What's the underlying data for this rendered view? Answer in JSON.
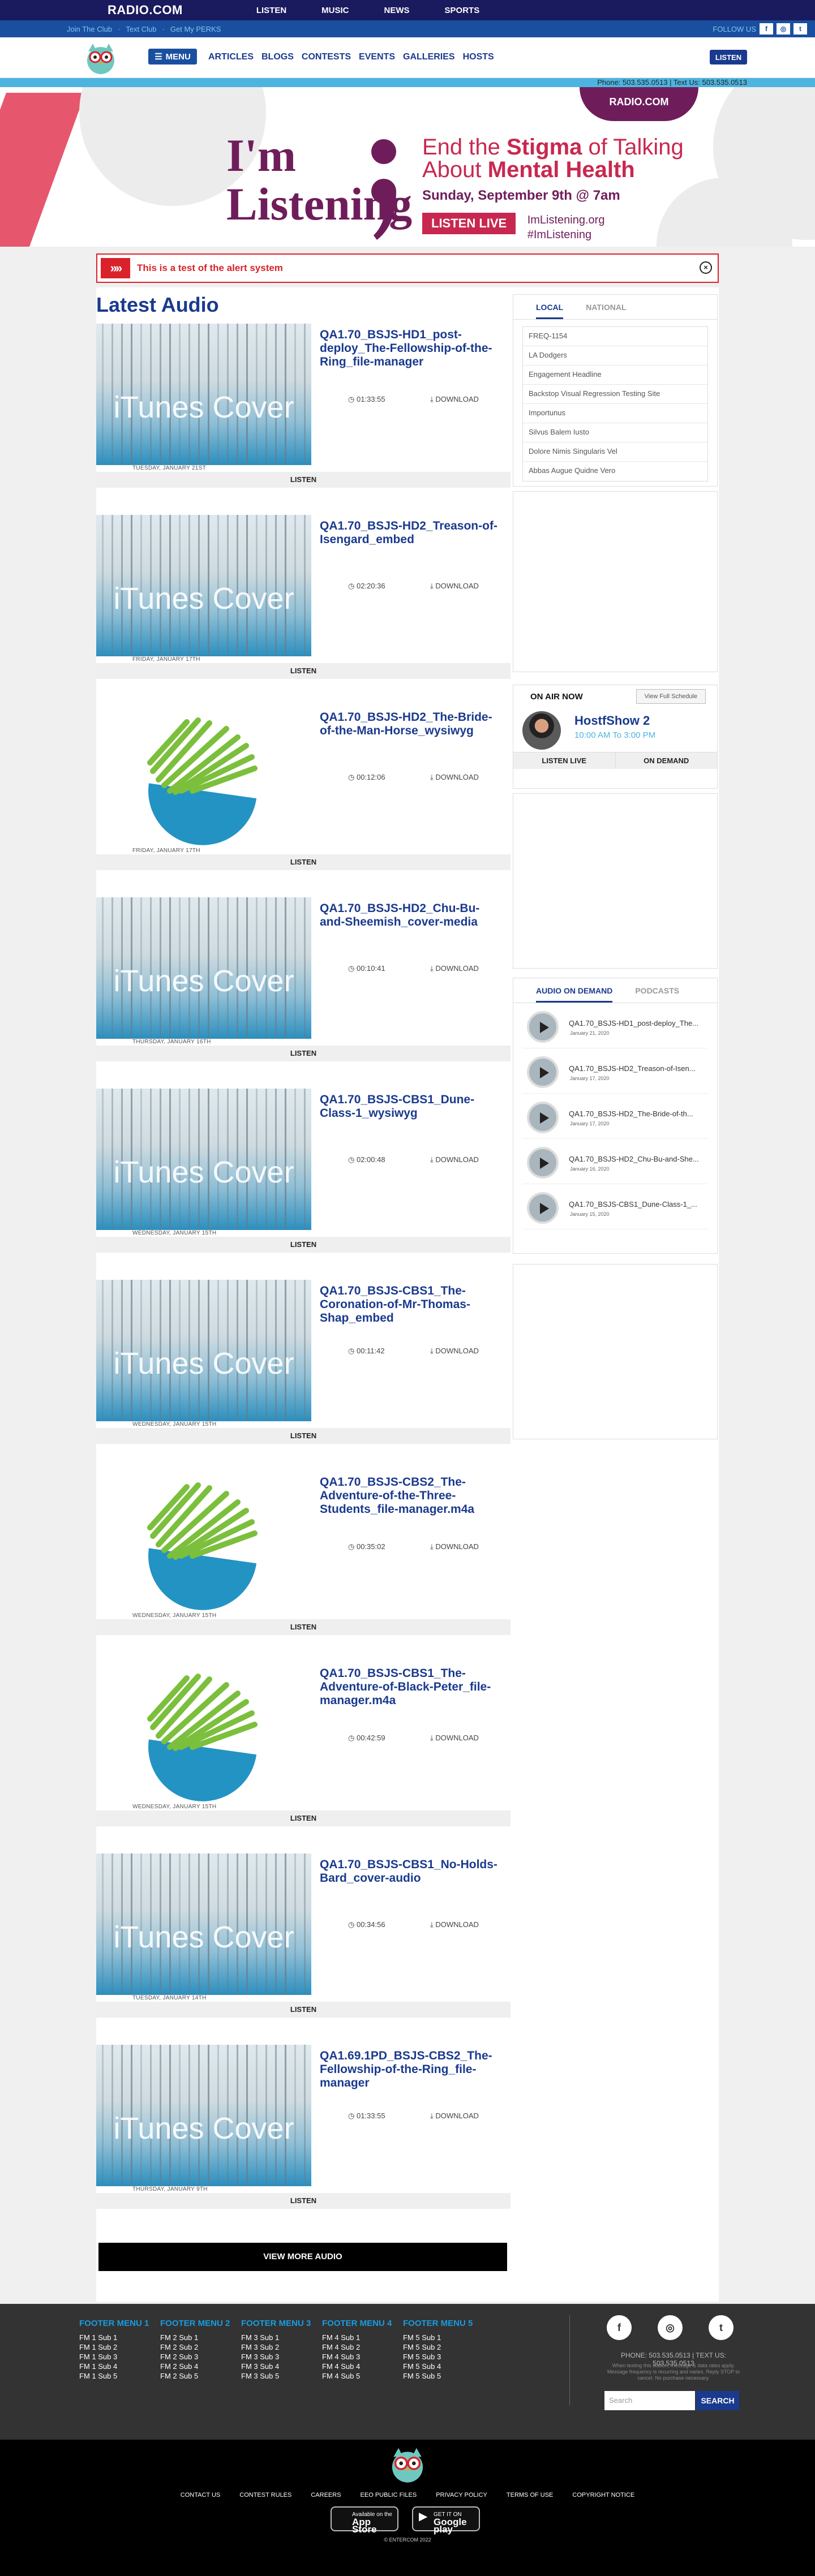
{
  "topbar": {
    "logo": "RADIO.COM",
    "nav": [
      "LISTEN",
      "MUSIC",
      "NEWS",
      "SPORTS"
    ]
  },
  "subbar": {
    "links": [
      "Join The Club",
      "Text Club",
      "Get My PERKS"
    ],
    "follow_label": "FOLLOW US"
  },
  "mainnav": {
    "menu_label": "MENU",
    "links": [
      "ARTICLES",
      "BLOGS",
      "CONTESTS",
      "EVENTS",
      "GALLERIES",
      "HOSTS"
    ],
    "listen_label": "LISTEN"
  },
  "phonebar": "Phone: 503.535.0513 | Text Us: 503.535.0513",
  "hero": {
    "badge": "RADIO.COM",
    "imlistening": "I'm Listening",
    "headline_pre": "End the ",
    "headline_bold": "Stigma",
    "headline_mid": " of Talking About ",
    "headline_bold2": "Mental Health",
    "date": "Sunday, September 9th @ 7am",
    "cta": "LISTEN LIVE",
    "tag1": "ImListening.org",
    "tag2": "#ImListening"
  },
  "alert": {
    "message": "This is a test of the alert system"
  },
  "latest_title": "Latest Audio",
  "cards": [
    {
      "title": "QA1.70_BSJS-HD1_post-deploy_The-Fellowship-of-the-Ring_file-manager",
      "duration": "01:33:55",
      "download": "DOWNLOAD",
      "date": "TUESDAY, JANUARY 21ST",
      "thumb": "itunes",
      "listen": "LISTEN"
    },
    {
      "title": "QA1.70_BSJS-HD2_Treason-of-Isengard_embed",
      "duration": "02:20:36",
      "download": "DOWNLOAD",
      "date": "FRIDAY, JANUARY 17TH",
      "thumb": "itunes",
      "listen": "LISTEN"
    },
    {
      "title": "QA1.70_BSJS-HD2_The-Bride-of-the-Man-Horse_wysiwyg",
      "duration": "00:12:06",
      "download": "DOWNLOAD",
      "date": "FRIDAY, JANUARY 17TH",
      "thumb": "pill",
      "listen": "LISTEN"
    },
    {
      "title": "QA1.70_BSJS-HD2_Chu-Bu-and-Sheemish_cover-media",
      "duration": "00:10:41",
      "download": "DOWNLOAD",
      "date": "THURSDAY, JANUARY 16TH",
      "thumb": "itunes",
      "listen": "LISTEN"
    },
    {
      "title": "QA1.70_BSJS-CBS1_Dune-Class-1_wysiwyg",
      "duration": "02:00:48",
      "download": "DOWNLOAD",
      "date": "WEDNESDAY, JANUARY 15TH",
      "thumb": "itunes",
      "listen": "LISTEN"
    },
    {
      "title": "QA1.70_BSJS-CBS1_The-Coronation-of-Mr-Thomas-Shap_embed",
      "duration": "00:11:42",
      "download": "DOWNLOAD",
      "date": "WEDNESDAY, JANUARY 15TH",
      "thumb": "itunes",
      "listen": "LISTEN"
    },
    {
      "title": "QA1.70_BSJS-CBS2_The-Adventure-of-the-Three-Students_file-manager.m4a",
      "duration": "00:35:02",
      "download": "DOWNLOAD",
      "date": "WEDNESDAY, JANUARY 15TH",
      "thumb": "pill",
      "listen": "LISTEN"
    },
    {
      "title": "QA1.70_BSJS-CBS1_The-Adventure-of-Black-Peter_file-manager.m4a",
      "duration": "00:42:59",
      "download": "DOWNLOAD",
      "date": "WEDNESDAY, JANUARY 15TH",
      "thumb": "pill",
      "listen": "LISTEN"
    },
    {
      "title": "QA1.70_BSJS-CBS1_No-Holds-Bard_cover-audio",
      "duration": "00:34:56",
      "download": "DOWNLOAD",
      "date": "TUESDAY, JANUARY 14TH",
      "thumb": "itunes",
      "listen": "LISTEN"
    },
    {
      "title": "QA1.69.1PD_BSJS-CBS2_The-Fellowship-of-the-Ring_file-manager",
      "duration": "01:33:55",
      "download": "DOWNLOAD",
      "date": "THURSDAY, JANUARY 9TH",
      "thumb": "itunes",
      "listen": "LISTEN"
    }
  ],
  "thumb_text": "iTunes Cover",
  "view_more": "VIEW MORE AUDIO",
  "local_widget": {
    "tabs": [
      "LOCAL",
      "NATIONAL"
    ],
    "items": [
      "FREQ-1154",
      "LA Dodgers",
      "Engagement Headline",
      "Backstop Visual Regression Testing Site",
      "Importunus",
      "Silvus Balem Iusto",
      "Dolore Nimis Singularis Vel",
      "Abbas Augue Quidne Vero"
    ]
  },
  "onair": {
    "title": "ON AIR NOW",
    "schedule": "View Full Schedule",
    "host": "HostfShow 2",
    "time": "10:00 AM To 3:00 PM",
    "btn_listen": "LISTEN LIVE",
    "btn_demand": "ON DEMAND"
  },
  "aod": {
    "tabs": [
      "AUDIO ON DEMAND",
      "PODCASTS"
    ],
    "items": [
      {
        "name": "QA1.70_BSJS-HD1_post-deploy_The...",
        "date": "January 21, 2020"
      },
      {
        "name": "QA1.70_BSJS-HD2_Treason-of-Isen...",
        "date": "January 17, 2020"
      },
      {
        "name": "QA1.70_BSJS-HD2_The-Bride-of-th...",
        "date": "January 17, 2020"
      },
      {
        "name": "QA1.70_BSJS-HD2_Chu-Bu-and-She...",
        "date": "January 16, 2020"
      },
      {
        "name": "QA1.70_BSJS-CBS1_Dune-Class-1_...",
        "date": "January 15, 2020"
      }
    ]
  },
  "footer": {
    "menus": [
      {
        "title": "FOOTER MENU 1",
        "items": [
          "FM 1 Sub 1",
          "FM 1 Sub 2",
          "FM 1 Sub 3",
          "FM 1 Sub 4",
          "FM 1 Sub 5"
        ]
      },
      {
        "title": "FOOTER MENU 2",
        "items": [
          "FM 2 Sub 1",
          "FM 2 Sub 2",
          "FM 2 Sub 3",
          "FM 2 Sub 4",
          "FM 2 Sub 5"
        ]
      },
      {
        "title": "FOOTER MENU 3",
        "items": [
          "FM 3 Sub 1",
          "FM 3 Sub 2",
          "FM 3 Sub 3",
          "FM 3 Sub 4",
          "FM 3 Sub 5"
        ]
      },
      {
        "title": "FOOTER MENU 4",
        "items": [
          "FM 4 Sub 1",
          "FM 4 Sub 2",
          "FM 4 Sub 3",
          "FM 4 Sub 4",
          "FM 4 Sub 5"
        ]
      },
      {
        "title": "FOOTER MENU 5",
        "items": [
          "FM 5 Sub 1",
          "FM 5 Sub 2",
          "FM 5 Sub 3",
          "FM 5 Sub 4",
          "FM 5 Sub 5"
        ]
      }
    ],
    "phone": "PHONE: 503.535.0513 | TEXT US: 503.535.0513",
    "disclaimer": "When texting this station, message & data rates apply. Message frequency is recurring and varies. Reply STOP to cancel. No purchase necessary.",
    "search_placeholder": "Search",
    "search_button": "SEARCH",
    "links": [
      "CONTACT US",
      "CONTEST RULES",
      "CAREERS",
      "EEO PUBLIC FILES",
      "PRIVACY POLICY",
      "TERMS OF USE",
      "COPYRIGHT NOTICE"
    ],
    "appstore_small": "Available on the",
    "appstore_big": "App Store",
    "googleplay_small": "GET IT ON",
    "googleplay_big": "Google play",
    "copyright": "© ENTERCOM 2022"
  },
  "colors": {
    "navy": "#1a3a8e",
    "brand_purple": "#6f1d5a",
    "brand_red": "#c8284f",
    "alert_red": "#d9222a",
    "cyan": "#4db4e0"
  }
}
